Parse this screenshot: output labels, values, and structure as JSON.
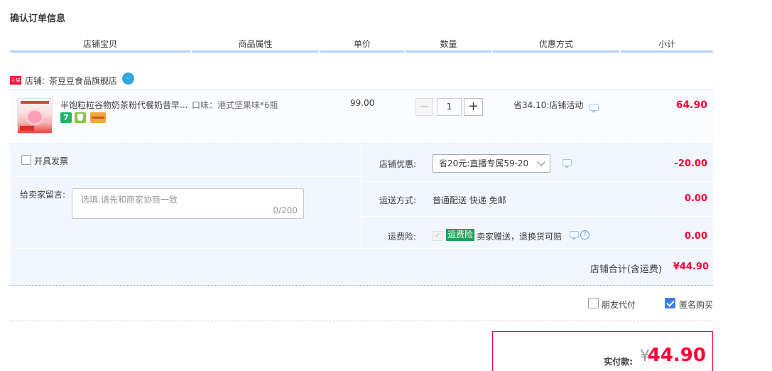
{
  "page": {
    "title": "确认订单信息"
  },
  "columns": [
    "店铺宝贝",
    "商品属性",
    "单价",
    "数量",
    "优惠方式",
    "小计"
  ],
  "shop": {
    "badge": "天猫",
    "label": "店铺:",
    "name": "茶豆豆食品旗舰店",
    "ww_icon": "wangwang-chat-icon"
  },
  "item": {
    "title": "半饱粒粒谷物奶茶粉代餐奶昔早...",
    "service_7": "7",
    "attr": "口味：港式坚果味*6瓶",
    "price": "99.00",
    "quantity": "1",
    "minus": "−",
    "plus": "+",
    "promo": "省34.10:店铺活动",
    "subtotal": "64.90"
  },
  "options": {
    "invoice_label": "开具发票",
    "invoice_checked": false,
    "message_label": "给卖家留言:",
    "message_placeholder": "选填,请先和商家协商一致",
    "message_count": "0/200",
    "coupon_label": "店铺优惠:",
    "coupon_value": "省20元:直播专属59-20",
    "coupon_amount": "-20.00",
    "shipping_label": "运送方式:",
    "shipping_value": "普通配送 快递 免邮",
    "shipping_amount": "0.00",
    "insurance_label": "运费险:",
    "insurance_badge": "运费险",
    "insurance_text": "卖家赠送，退换货可赔",
    "insurance_amount": "0.00",
    "help_glyph": "?"
  },
  "shop_total": {
    "label": "店铺合计(含运费)",
    "amount": "¥44.90"
  },
  "extras": {
    "friend_pay_label": "朋友代付",
    "friend_pay_checked": false,
    "anonymous_label": "匿名购买",
    "anonymous_checked": true
  },
  "payment": {
    "label": "实付款:",
    "currency": "¥",
    "amount": "44.90"
  },
  "colors": {
    "accent_red": "#ff0036",
    "header_line": "#b2d1ff",
    "panel_bg": "#f2f7ff",
    "checkbox_blue": "#3d7fe0",
    "insurance_green": "#21a05a"
  }
}
